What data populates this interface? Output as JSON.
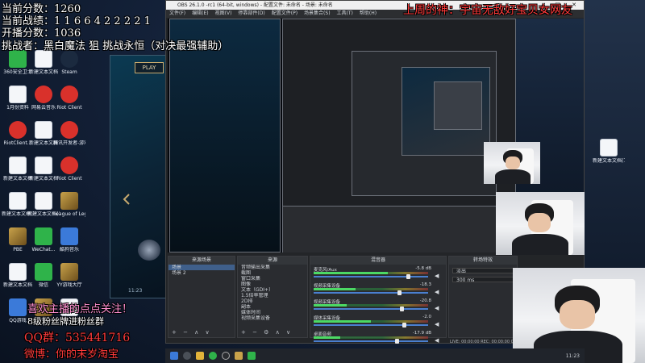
{
  "stream_overlay": {
    "current_points_label": "当前分数：",
    "current_points_value": "1260",
    "current_kills_label": "当前战绩：",
    "current_kills_value": "1 1 6 6 4 2 2 2 2 1",
    "start_points_label": "开播分数：",
    "start_points_value": "1036",
    "challenger_label": "挑战者：",
    "challenger_value": "黑白魔法 狙 挑战永恒（对决最强辅助）",
    "banner_top": "上周的神：宇宙无敌好宝贝女网友",
    "follow_notice": "喜欢主播的点点关注！",
    "fan_group_notice": "8级粉丝牌进粉丝群",
    "qq_group": "QQ群：535441716",
    "weibo": "微博：你的末岁淘宝"
  },
  "desktop": {
    "icons": [
      {
        "name": "360安全卫士",
        "kind": "green"
      },
      {
        "name": "新建文本文档",
        "kind": "doc"
      },
      {
        "name": "Steam",
        "kind": "steam"
      },
      {
        "name": "1月份资料",
        "kind": "doc"
      },
      {
        "name": "网易云音乐",
        "kind": "red"
      },
      {
        "name": "Riot Client",
        "kind": "red"
      },
      {
        "name": "RiotClient...",
        "kind": "red"
      },
      {
        "name": "新建文本文档",
        "kind": "doc"
      },
      {
        "name": "腾讯开发者-游戏",
        "kind": "red"
      },
      {
        "name": "新建文本文档",
        "kind": "doc"
      },
      {
        "name": "新建文本文档",
        "kind": "doc"
      },
      {
        "name": "Riot Client",
        "kind": "red"
      },
      {
        "name": "新建文本文档(14)",
        "kind": "doc"
      },
      {
        "name": "新建文本文档(13)",
        "kind": "doc"
      },
      {
        "name": "League of Legends",
        "kind": "gold"
      },
      {
        "name": "PBE",
        "kind": "gold"
      },
      {
        "name": "WeChat...",
        "kind": "green"
      },
      {
        "name": "酷狗音乐",
        "kind": "blue"
      },
      {
        "name": "新建文本文档",
        "kind": "doc"
      },
      {
        "name": "微信",
        "kind": "green"
      },
      {
        "name": "YY游戏大厅",
        "kind": "gold"
      },
      {
        "name": "QQ游戏",
        "kind": "blue"
      },
      {
        "name": "英雄联盟WeGame",
        "kind": "gold"
      },
      {
        "name": "新建文本文档",
        "kind": "doc"
      }
    ],
    "right_icons": [
      {
        "name": "新建文本文档(7)",
        "kind": "doc"
      }
    ]
  },
  "lol_client": {
    "play_label": "PLAY",
    "time_label": "11:23"
  },
  "obs": {
    "title": "OBS 26.1.0 -rc1 (64-bit, windows) - 配置文件: 未命名 - 场景: 未命名",
    "menu": [
      "文件(F)",
      "编辑(E)",
      "视图(V)",
      "停靠部件(D)",
      "配置文件(P)",
      "场景集合(S)",
      "工具(T)",
      "帮助(H)"
    ],
    "scenes_header": "来源场景",
    "scenes": [
      "场景",
      "场景 2"
    ],
    "sources_header": "来源",
    "sources": [
      "音频输出采集",
      "截图",
      "窗口采集",
      "图像",
      "文本（GDI+）",
      "1.5倍率管理",
      "2D排",
      "副本",
      "媒体时间",
      "视频采集设备"
    ],
    "mixer_header": "混音器",
    "mixer": [
      {
        "name": "麦克风/Aux",
        "db": "-5.8 dB",
        "level": 0.62,
        "fader": 0.78
      },
      {
        "name": "视频采集设备",
        "db": "-18.3",
        "level": 0.35,
        "fader": 0.7
      },
      {
        "name": "视频采集设备",
        "db": "-20.8",
        "level": 0.28,
        "fader": 0.72
      },
      {
        "name": "媒体采集设备",
        "db": "-2.0",
        "level": 0.48,
        "fader": 0.74
      },
      {
        "name": "桌面音频",
        "db": "-17.9 dB",
        "level": 0.22,
        "fader": 0.68
      }
    ],
    "transitions_header": "转场特效",
    "transition": "淡出",
    "transition_duration": "300 ms",
    "status": "LIVE: 00:00:00  REC: 00:00:00  CPU: 4.8%, 60.00 fps"
  },
  "taskbar": {
    "clock": "11:23"
  },
  "colors": {
    "obs_bg": "#232528",
    "overlay_red": "#ff3a3a",
    "overlay_pink": "#ff8fd0",
    "accent_blue": "#3f5f8a"
  }
}
